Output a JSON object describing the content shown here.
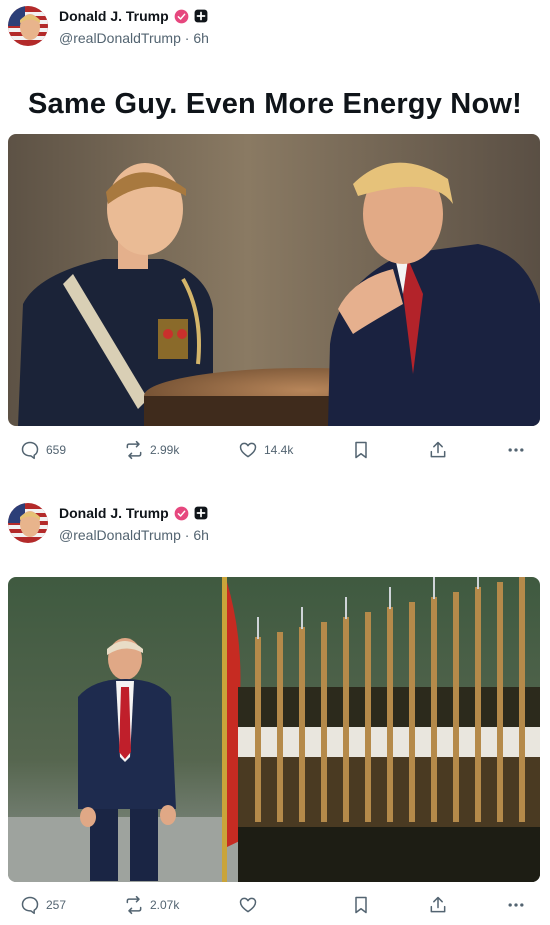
{
  "posts": [
    {
      "author": {
        "display_name": "Donald J. Trump",
        "handle": "@realDonaldTrump",
        "time": "6h"
      },
      "text": "Same Guy. Even More Energy Now!",
      "media": {
        "type": "image",
        "description_icon": "image"
      },
      "actions": {
        "replies": "659",
        "reposts": "2.99k",
        "likes": "14.4k"
      }
    },
    {
      "author": {
        "display_name": "Donald J. Trump",
        "handle": "@realDonaldTrump",
        "time": "6h"
      },
      "media": {
        "type": "image",
        "description_icon": "image"
      },
      "actions": {
        "replies": "257",
        "reposts": "2.07k",
        "likes": ""
      }
    }
  ],
  "colors": {
    "verified": "#e6477e",
    "muted": "#536471",
    "text": "#0f1419"
  }
}
